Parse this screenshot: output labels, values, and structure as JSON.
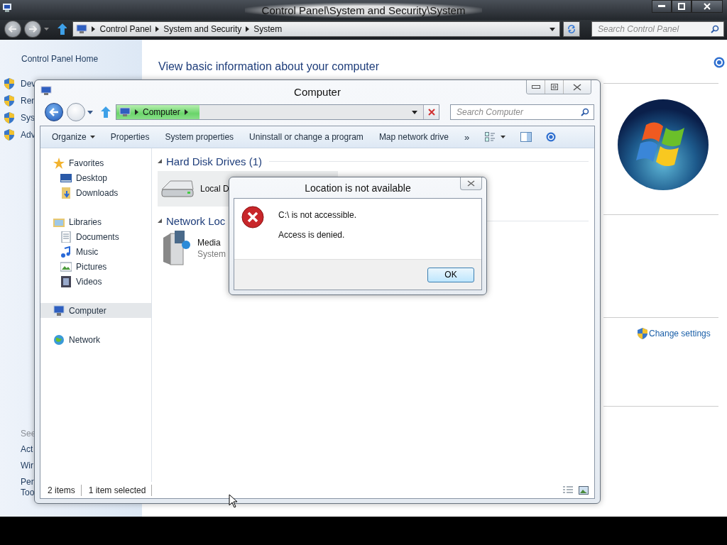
{
  "control_panel": {
    "title": "Control Panel\\System and Security\\System",
    "breadcrumb": [
      "Control Panel",
      "System and Security",
      "System"
    ],
    "search": {
      "placeholder": "Search Control Panel"
    },
    "home": "Control Panel Home",
    "tasks": [
      "Dev",
      "Ren",
      "Sys",
      "Adv"
    ],
    "see_also": "See",
    "links": [
      "Act",
      "Wir",
      "Per\nToo"
    ],
    "heading": "View basic information about your computer",
    "change_settings": "Change settings"
  },
  "explorer": {
    "title": "Computer",
    "breadcrumb": [
      "Computer"
    ],
    "search": {
      "placeholder": "Search Computer"
    },
    "toolbar": [
      {
        "label": "Organize",
        "dropdown": true
      },
      {
        "label": "Properties",
        "dropdown": false
      },
      {
        "label": "System properties",
        "dropdown": false
      },
      {
        "label": "Uninstall or change a program",
        "dropdown": false
      },
      {
        "label": "Map network drive",
        "dropdown": false
      }
    ],
    "overflow": "»",
    "nav": [
      {
        "label": "Favorites",
        "kind": "star",
        "selected": false,
        "children": [
          {
            "label": "Desktop",
            "kind": "desktop",
            "selected": false
          },
          {
            "label": "Downloads",
            "kind": "downloads",
            "selected": false
          }
        ]
      },
      {
        "label": "Libraries",
        "kind": "libraries",
        "selected": false,
        "children": [
          {
            "label": "Documents",
            "kind": "documents",
            "selected": false
          },
          {
            "label": "Music",
            "kind": "music",
            "selected": false
          },
          {
            "label": "Pictures",
            "kind": "pictures",
            "selected": false
          },
          {
            "label": "Videos",
            "kind": "videos",
            "selected": false
          }
        ]
      },
      {
        "label": "Computer",
        "kind": "computer",
        "selected": true
      },
      {
        "label": "Network",
        "kind": "network",
        "selected": false
      }
    ],
    "groups": [
      {
        "heading": "Hard Disk Drives (1)",
        "items": [
          {
            "name": "Local D",
            "kind": "drive",
            "selected": true
          }
        ]
      },
      {
        "heading": "Network Loc",
        "items": [
          {
            "name": "Media",
            "subtitle": "System",
            "kind": "media",
            "selected": false
          }
        ]
      }
    ],
    "status": [
      "2 items",
      "1 item selected"
    ]
  },
  "dialog": {
    "title": "Location is not available",
    "messages": [
      "C:\\ is not accessible.",
      "Access is denied."
    ],
    "button": "OK"
  }
}
